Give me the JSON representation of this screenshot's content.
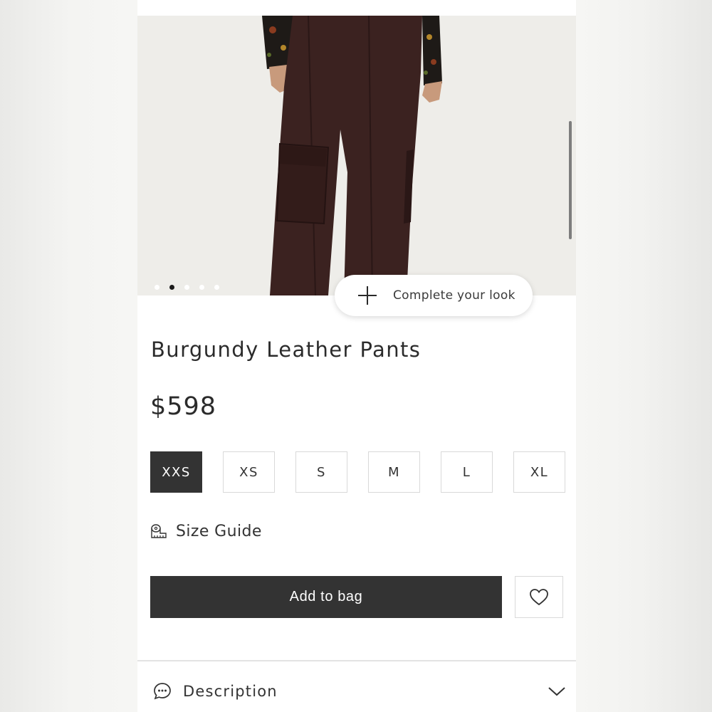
{
  "product": {
    "image_dots": [
      false,
      true,
      false,
      false,
      false
    ],
    "complete_look_label": "Complete your look",
    "title": "Burgundy Leather Pants",
    "price": "$598",
    "sizes": [
      {
        "label": "XXS",
        "selected": true
      },
      {
        "label": "XS",
        "selected": false
      },
      {
        "label": "S",
        "selected": false
      },
      {
        "label": "M",
        "selected": false
      },
      {
        "label": "L",
        "selected": false
      },
      {
        "label": "XL",
        "selected": false
      }
    ],
    "size_guide_label": "Size Guide",
    "add_to_bag_label": "Add to bag",
    "description_label": "Description"
  },
  "colors": {
    "primary_button": "#333333",
    "pants": "#3b2220",
    "background": "#ffffff"
  },
  "icons": [
    "plus-icon",
    "tape-measure-icon",
    "heart-icon",
    "chat-bubble-icon",
    "chevron-down-icon"
  ]
}
